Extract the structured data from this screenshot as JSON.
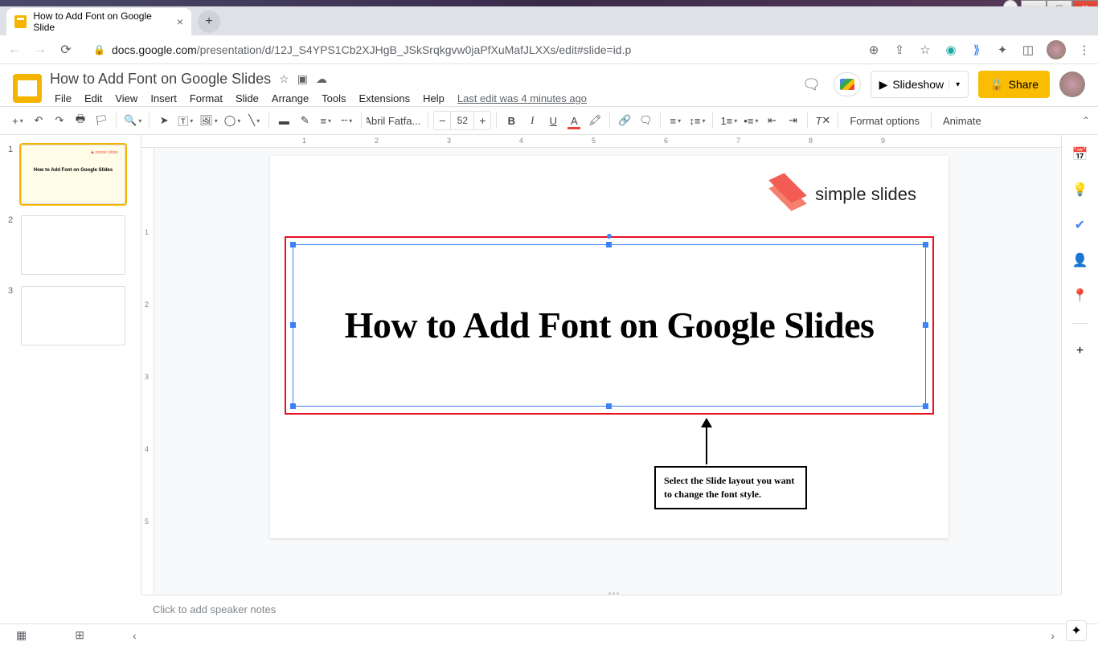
{
  "browser": {
    "tab_title": "How to Add Font on Google Slide",
    "url_host": "docs.google.com",
    "url_path": "/presentation/d/12J_S4YPS1Cb2XJHgB_JSkSrqkgvw0jaPfXuMafJLXXs/edit#slide=id.p"
  },
  "doc": {
    "title": "How to Add Font on  Google Slides",
    "menus": [
      "File",
      "Edit",
      "View",
      "Insert",
      "Format",
      "Slide",
      "Arrange",
      "Tools",
      "Extensions",
      "Help"
    ],
    "last_edit": "Last edit was 4 minutes ago",
    "slideshow_label": "Slideshow",
    "share_label": "Share"
  },
  "toolbar": {
    "font_name": "Abril Fatfa...",
    "font_size": "52",
    "format_options": "Format options",
    "animate": "Animate"
  },
  "filmstrip": {
    "slides": [
      {
        "num": "1",
        "title": "How to Add Font on Google Slides",
        "selected": true
      },
      {
        "num": "2",
        "title": "",
        "selected": false
      },
      {
        "num": "3",
        "title": "",
        "selected": false
      }
    ]
  },
  "ruler_h": [
    "1",
    "2",
    "3",
    "4",
    "5",
    "6",
    "7",
    "8",
    "9"
  ],
  "ruler_v": [
    "1",
    "2",
    "3",
    "4",
    "5"
  ],
  "slide": {
    "logo_text": "simple slides",
    "main_text": "How to Add Font on Google Slides",
    "callout": "Select the Slide layout you want to change the font style."
  },
  "notes_placeholder": "Click to add speaker notes"
}
